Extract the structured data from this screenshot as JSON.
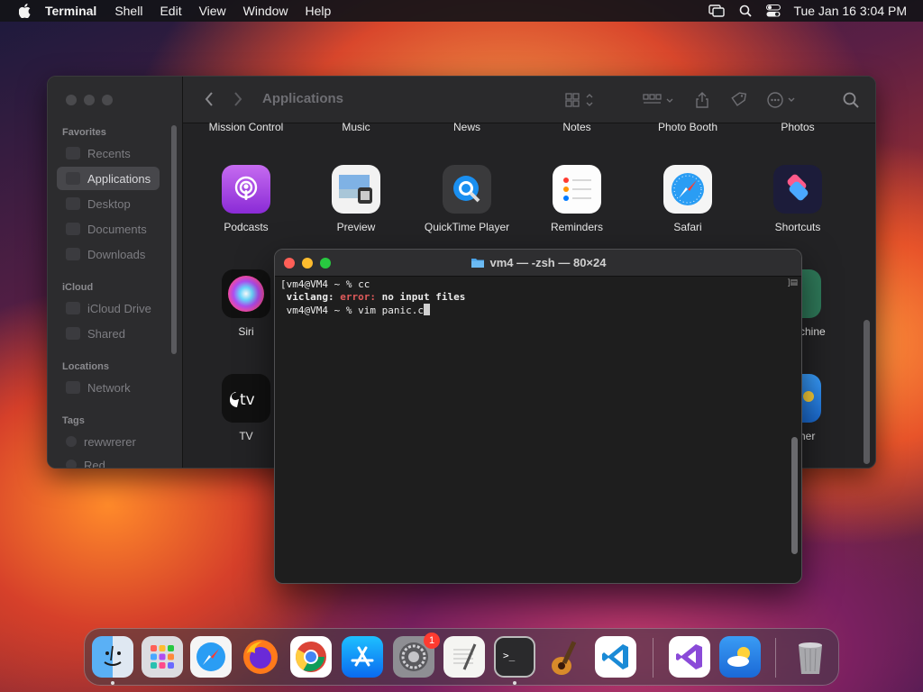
{
  "menubar": {
    "app_name": "Terminal",
    "items": [
      "Shell",
      "Edit",
      "View",
      "Window",
      "Help"
    ],
    "clock": "Tue Jan 16  3:04 PM"
  },
  "finder": {
    "title": "Applications",
    "sidebar": {
      "favorites_label": "Favorites",
      "favorites": [
        "Recents",
        "Applications",
        "Desktop",
        "Documents",
        "Downloads"
      ],
      "icloud_label": "iCloud",
      "icloud": [
        "iCloud Drive",
        "Shared"
      ],
      "locations_label": "Locations",
      "locations": [
        "Network"
      ],
      "tags_label": "Tags",
      "tags": [
        "rewwrerer",
        "Red"
      ]
    },
    "top_row_labels": [
      "Mission Control",
      "Music",
      "News",
      "Notes",
      "Photo Booth",
      "Photos"
    ],
    "apps_row2": [
      "Podcasts",
      "Preview",
      "QuickTime Player",
      "Reminders",
      "Safari",
      "Shortcuts"
    ],
    "apps_row3": [
      "Siri",
      "chine"
    ],
    "apps_row4": [
      "TV",
      "her"
    ]
  },
  "terminal": {
    "title": "vm4 — -zsh — 80×24",
    "line1": "vm4@VM4 ~ % cc",
    "line2_prefix": "viclang: ",
    "line2_error": "error:",
    "line2_msg": " no input files",
    "line3": "vm4@VM4 ~ % vim panic.c"
  },
  "dock": {
    "apps": [
      "Finder",
      "Launchpad",
      "Safari",
      "Firefox",
      "Google Chrome",
      "App Store",
      "System Settings",
      "TextEdit",
      "Terminal",
      "GarageBand",
      "Visual Studio Code",
      "Visual Studio",
      "Weather",
      "Trash"
    ],
    "settings_badge": "1",
    "tv_icon_text": "tv",
    "terminal_icon_text": ">_"
  },
  "colors": {
    "accent_error": "#e05b5b",
    "traffic_red": "#ff5f57",
    "traffic_yellow": "#febc2e",
    "traffic_green": "#28c840"
  }
}
